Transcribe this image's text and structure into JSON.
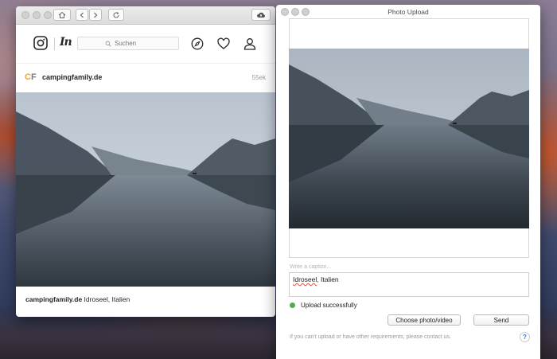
{
  "browser": {
    "search": {
      "placeholder": "Suchen"
    },
    "post": {
      "username": "campingfamily.de",
      "time_ago": "55ek",
      "avatar_letters": "CF",
      "caption_user": "campingfamily.de",
      "caption_text": "Idroseel, Italien"
    },
    "icons": [
      "home-icon",
      "back-icon",
      "forward-icon",
      "reload-icon",
      "upload-cloud-icon",
      "instagram-icon",
      "explore-compass-icon",
      "heart-icon",
      "profile-icon",
      "search-icon"
    ]
  },
  "upload": {
    "window_title": "Photo Upload",
    "caption_label": "Write a caption...",
    "caption_word": "Idroseel",
    "caption_rest": ", Italien",
    "status_text": "Upload successfully",
    "status_color": "#4cae4c",
    "choose_label": "Choose photo/video",
    "send_label": "Send",
    "footer_note": "If you can't upload or have other requirements, please contact us.",
    "help_label": "?"
  }
}
